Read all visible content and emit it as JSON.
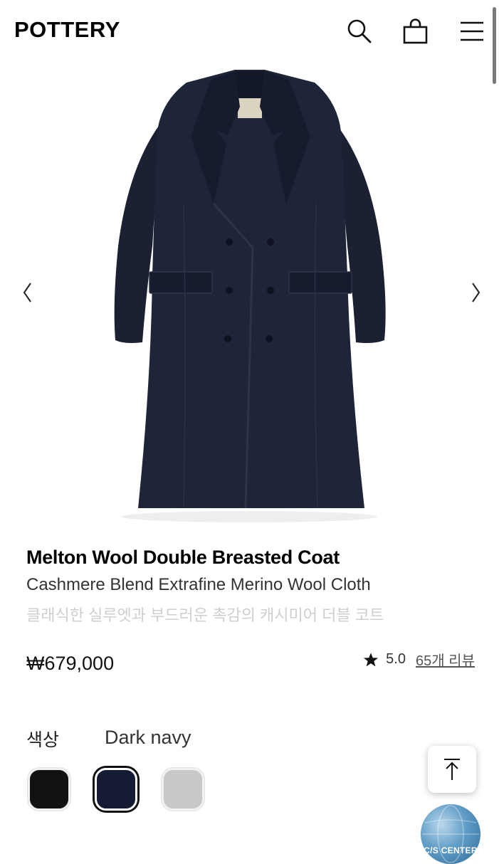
{
  "header": {
    "logo": "POTTERY",
    "icons": [
      "search-icon",
      "shopping-bag-icon",
      "menu-icon"
    ]
  },
  "hero": {
    "image": "navy double-breasted long wool coat",
    "prev_icon": "chevron-left-icon",
    "next_icon": "chevron-right-icon"
  },
  "product": {
    "title": "Melton Wool Double Breasted Coat",
    "subtitle": "Cashmere Blend Extrafine Merino Wool Cloth",
    "description": "클래식한 실루엣과 부드러운 촉감의 캐시미어 더블 코트",
    "price": "₩679,000",
    "rating": "5.0",
    "reviews": "65개 리뷰"
  },
  "options": {
    "color_label": "색상",
    "selected_color": "Dark navy",
    "swatches": [
      {
        "color": "#121212",
        "selected": false
      },
      {
        "color": "#141b33",
        "selected": true
      },
      {
        "color": "#c8c8c8",
        "selected": false
      }
    ]
  },
  "floating": {
    "scroll_top_icon": "arrow-up-to-top-icon",
    "cs_label": "C/S CENTER"
  },
  "colors": {
    "coat": "#1b2133",
    "text": "#111111",
    "muted": "#cfcfcf"
  }
}
